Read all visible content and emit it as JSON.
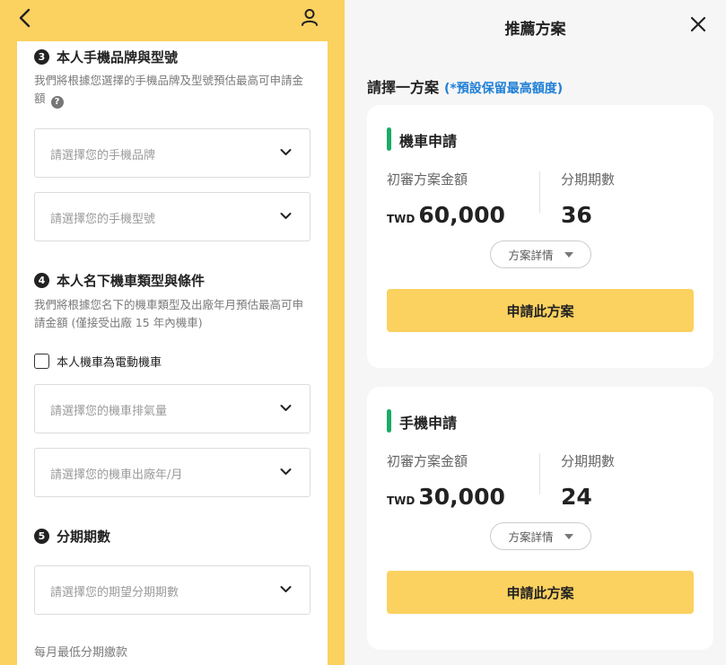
{
  "left": {
    "section3": {
      "number": "3",
      "title": "本人手機品牌與型號",
      "desc": "我們將根據您選擇的手機品牌及型號預估最高可申請金額",
      "help": "?",
      "brand_placeholder": "請選擇您的手機品牌",
      "model_placeholder": "請選擇您的手機型號"
    },
    "section4": {
      "number": "4",
      "title": "本人名下機車類型與條件",
      "desc": "我們將根據您名下的機車類型及出廠年月預估最高可申請金額 (僅接受出廠 15 年內機車)",
      "electric_label": "本人機車為電動機車",
      "cc_placeholder": "請選擇您的機車排氣量",
      "date_placeholder": "請選擇您的機車出廠年/月"
    },
    "section5": {
      "number": "5",
      "title": "分期期數",
      "term_placeholder": "請選擇您的期望分期期數"
    },
    "min_payment_label": "每月最低分期繳款"
  },
  "right": {
    "title": "推薦方案",
    "pick_label": "請擇一方案",
    "pick_note": "(*預設保留最高額度)",
    "plans": [
      {
        "name": "機車申請",
        "amount_label": "初審方案金額",
        "term_label": "分期期數",
        "currency": "TWD",
        "amount": "60,000",
        "term": "36",
        "detail_label": "方案詳情",
        "apply_label": "申請此方案"
      },
      {
        "name": "手機申請",
        "amount_label": "初審方案金額",
        "term_label": "分期期數",
        "currency": "TWD",
        "amount": "30,000",
        "term": "24",
        "detail_label": "方案詳情",
        "apply_label": "申請此方案"
      }
    ]
  },
  "colors": {
    "brand_yellow": "#fbd15f",
    "accent_green": "#1aab67",
    "note_blue": "#1f7fd6"
  },
  "icons": [
    "back-arrow-icon",
    "user-icon",
    "help-icon",
    "chevron-down-icon",
    "close-icon",
    "triangle-down-icon"
  ]
}
